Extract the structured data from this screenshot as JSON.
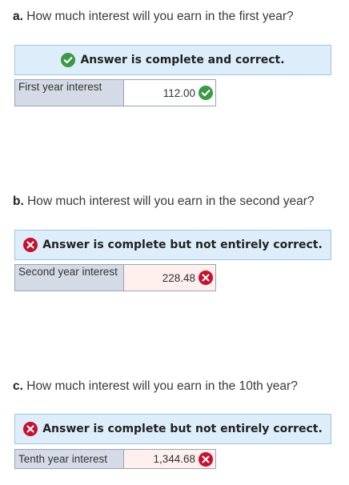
{
  "parts": [
    {
      "letter": "a.",
      "question": " How much interest will you earn in the first year?",
      "status": "Answer is complete and correct.",
      "status_type": "correct",
      "field_label": "First year interest",
      "value": "112.00",
      "value_status": "correct"
    },
    {
      "letter": "b.",
      "question": " How much interest will you earn in the second year?",
      "status": "Answer is complete but not entirely correct.",
      "status_type": "incorrect",
      "field_label": "Second year interest",
      "value": "228.48",
      "value_status": "incorrect"
    },
    {
      "letter": "c.",
      "question": " How much interest will you earn in the 10th year?",
      "status": "Answer is complete but not entirely correct.",
      "status_type": "incorrect",
      "field_label": "Tenth year interest",
      "value": "1,344.68",
      "value_status": "incorrect"
    }
  ],
  "icons": {
    "correct": "check-circle-icon",
    "incorrect": "x-circle-icon"
  },
  "colors": {
    "correct_green": "#3c9a47",
    "incorrect_red": "#c8102e",
    "banner_bg": "#ddeefa",
    "banner_border": "#9cc7e3",
    "label_bg": "#d5dbe6",
    "wrong_value_bg": "#fff0ee"
  }
}
